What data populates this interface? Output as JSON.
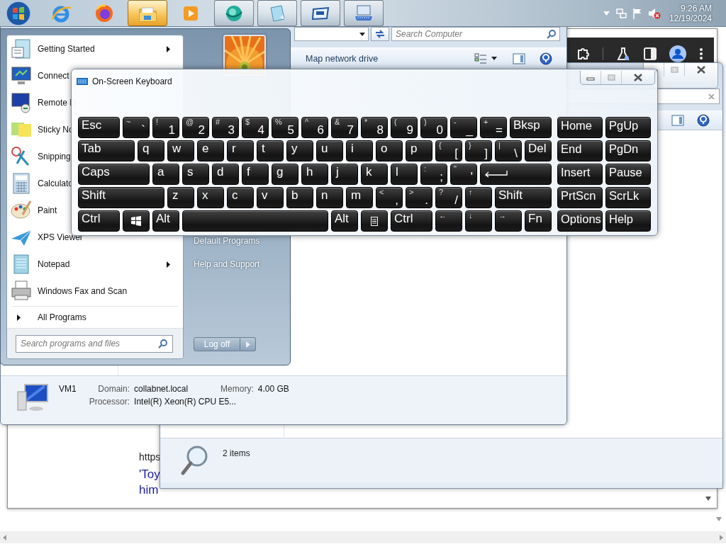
{
  "taskbar": {
    "start_button": {
      "selected": false
    },
    "items": [
      {
        "running": false,
        "selected": false
      },
      {
        "running": false,
        "selected": false
      },
      {
        "running": true,
        "selected": true
      },
      {
        "running": false,
        "selected": false
      },
      {
        "running": true,
        "selected": false
      },
      {
        "running": true,
        "selected": false
      },
      {
        "running": true,
        "selected": false
      },
      {
        "running": true,
        "selected": false
      }
    ],
    "time": "9:26 AM",
    "date": "12/19/2024"
  },
  "browser": {
    "lines": [
      {
        "kind": "url",
        "text": "https"
      },
      {
        "kind": "link",
        "text": "'Toy"
      },
      {
        "kind": "link",
        "text": "him"
      }
    ]
  },
  "back_explorer": {
    "status": "2 items"
  },
  "explorer": {
    "search": {
      "placeholder": "Search Computer"
    },
    "toolbar": [
      "Map network drive"
    ],
    "details": {
      "name": "VM1",
      "fields": [
        {
          "label": "Domain:",
          "value": "collabnet.local"
        },
        {
          "label": "Memory:",
          "value": "4.00 GB"
        },
        {
          "label": "Processor:",
          "value": "Intel(R) Xeon(R) CPU E5..."
        }
      ]
    }
  },
  "start_menu": {
    "programs": [
      {
        "label": "Getting Started",
        "submenu": true
      },
      {
        "label": "Connect"
      },
      {
        "label": "Remote D"
      },
      {
        "label": "Sticky No"
      },
      {
        "label": "Snipping"
      },
      {
        "label": "Calculato"
      },
      {
        "label": "Paint"
      },
      {
        "label": "XPS Viewer",
        "submenu": false
      },
      {
        "label": "Notepad",
        "submenu": true
      },
      {
        "label": "Windows Fax and Scan",
        "submenu": false
      }
    ],
    "all_programs": "All Programs",
    "search": {
      "placeholder": "Search programs and files"
    },
    "links": [
      "Default Programs",
      "Help and Support"
    ],
    "shutdown": "Log off"
  },
  "keyboard": {
    "title": "On-Screen Keyboard",
    "rows": [
      {
        "keys": [
          {
            "kind": "medium",
            "label": "Esc"
          },
          {
            "kind": "small",
            "shift": "~",
            "label": "`"
          },
          {
            "kind": "small",
            "shift": "!",
            "label": "1"
          },
          {
            "kind": "small",
            "shift": "@",
            "label": "2"
          },
          {
            "kind": "small",
            "shift": "#",
            "label": "3"
          },
          {
            "kind": "small",
            "shift": "$",
            "label": "4"
          },
          {
            "kind": "small",
            "shift": "%",
            "label": "5"
          },
          {
            "kind": "small",
            "shift": "^",
            "label": "6"
          },
          {
            "kind": "small",
            "shift": "&",
            "label": "7"
          },
          {
            "kind": "small",
            "shift": "*",
            "label": "8"
          },
          {
            "kind": "small",
            "shift": "(",
            "label": "9"
          },
          {
            "kind": "small",
            "shift": ")",
            "label": "0"
          },
          {
            "kind": "small",
            "shift": "-",
            "label": "_"
          },
          {
            "kind": "small",
            "shift": "+",
            "label": "="
          },
          {
            "kind": "medium",
            "label": "Bksp"
          }
        ]
      },
      {
        "keys": [
          {
            "kind": "large",
            "label": "Tab"
          },
          {
            "kind": "small",
            "label": "q"
          },
          {
            "kind": "small",
            "label": "w"
          },
          {
            "kind": "small",
            "label": "e"
          },
          {
            "kind": "small",
            "label": "r"
          },
          {
            "kind": "small",
            "label": "t"
          },
          {
            "kind": "small",
            "label": "y"
          },
          {
            "kind": "small",
            "label": "u"
          },
          {
            "kind": "small",
            "label": "i"
          },
          {
            "kind": "small",
            "label": "o"
          },
          {
            "kind": "small",
            "label": "p"
          },
          {
            "kind": "small",
            "shift": "{",
            "label": "["
          },
          {
            "kind": "small",
            "shift": "}",
            "label": "]"
          },
          {
            "kind": "small",
            "shift": "|",
            "label": "\\"
          },
          {
            "kind": "small",
            "label": "Del"
          }
        ]
      },
      {
        "keys": [
          {
            "kind": "xlarge",
            "label": "Caps"
          },
          {
            "kind": "small",
            "label": "a"
          },
          {
            "kind": "small",
            "label": "s"
          },
          {
            "kind": "small",
            "label": "d"
          },
          {
            "kind": "small",
            "label": "f"
          },
          {
            "kind": "small",
            "label": "g"
          },
          {
            "kind": "small",
            "label": "h"
          },
          {
            "kind": "small",
            "label": "j"
          },
          {
            "kind": "small",
            "label": "k"
          },
          {
            "kind": "small",
            "label": "l"
          },
          {
            "kind": "small",
            "shift": ":",
            "label": ";"
          },
          {
            "kind": "small",
            "shift": "\"",
            "label": "'"
          },
          {
            "kind": "enter"
          }
        ]
      },
      {
        "keys": [
          {
            "kind": "xxlarge",
            "label": "Shift"
          },
          {
            "kind": "small",
            "label": "z"
          },
          {
            "kind": "small",
            "label": "x"
          },
          {
            "kind": "small",
            "label": "c"
          },
          {
            "kind": "small",
            "label": "v"
          },
          {
            "kind": "small",
            "label": "b"
          },
          {
            "kind": "small",
            "label": "n"
          },
          {
            "kind": "small",
            "label": "m"
          },
          {
            "kind": "small",
            "shift": "<",
            "label": ","
          },
          {
            "kind": "small",
            "shift": ">",
            "label": "."
          },
          {
            "kind": "small",
            "shift": "?",
            "label": "/"
          },
          {
            "kind": "small",
            "shift": "↑"
          },
          {
            "kind": "large",
            "label": "Shift"
          }
        ]
      },
      {
        "keys": [
          {
            "kind": "medium",
            "label": "Ctrl"
          },
          {
            "kind": "logo"
          },
          {
            "kind": "small",
            "label": "Alt"
          },
          {
            "kind": "space"
          },
          {
            "kind": "small",
            "label": "Alt"
          },
          {
            "kind": "menu"
          },
          {
            "kind": "medium",
            "label": "Ctrl"
          },
          {
            "kind": "small",
            "shift": "←"
          },
          {
            "kind": "small",
            "shift": "↓"
          },
          {
            "kind": "small",
            "shift": "→"
          },
          {
            "kind": "small",
            "label": "Fn"
          }
        ]
      }
    ],
    "side": [
      [
        "Home",
        "PgUp"
      ],
      [
        "End",
        "PgDn"
      ],
      [
        "Insert",
        "Pause"
      ],
      [
        "PrtScn",
        "ScrLk"
      ],
      [
        "Options",
        "Help"
      ]
    ]
  }
}
